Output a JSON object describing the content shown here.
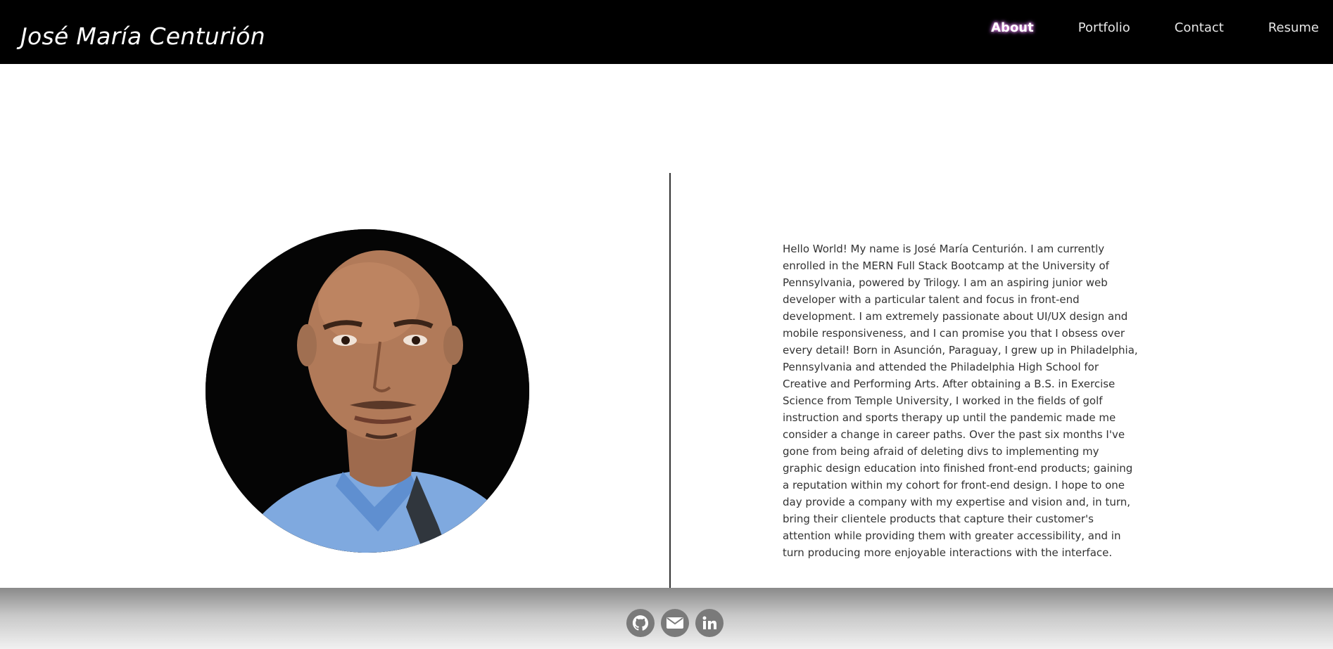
{
  "header": {
    "brand": "José María Centurión",
    "nav": [
      {
        "label": "About",
        "active": true
      },
      {
        "label": "Portfolio",
        "active": false
      },
      {
        "label": "Contact",
        "active": false
      },
      {
        "label": "Resume",
        "active": false
      }
    ]
  },
  "about": {
    "photo_description": "portrait-photo",
    "bio": "Hello World! My name is José María Centurión. I am currently enrolled in the MERN Full Stack Bootcamp at the University of Pennsylvania, powered by Trilogy. I am an aspiring junior web developer with a particular talent and focus in front-end development. I am extremely passionate about UI/UX design and mobile responsiveness, and I can promise you that I obsess over every detail! Born in Asunción, Paraguay, I grew up in Philadelphia, Pennsylvania and attended the Philadelphia High School for Creative and Performing Arts. After obtaining a B.S. in Exercise Science from Temple University, I worked in the fields of golf instruction and sports therapy up until the pandemic made me consider a change in career paths. Over the past six months I've gone from being afraid of deleting divs to implementing my graphic design education into finished front-end products; gaining a reputation within my cohort for front-end design. I hope to one day provide a company with my expertise and vision and, in turn, bring their clientele products that capture their customer's attention while providing them with greater accessibility, and in turn producing more enjoyable interactions with the interface."
  },
  "footer": {
    "social": [
      {
        "icon": "github-icon"
      },
      {
        "icon": "mail-icon"
      },
      {
        "icon": "linkedin-icon"
      }
    ]
  },
  "colors": {
    "header_bg": "#000000",
    "active_glow": "#ff9ff0",
    "footer_icon_bg": "#7a7a7a"
  }
}
